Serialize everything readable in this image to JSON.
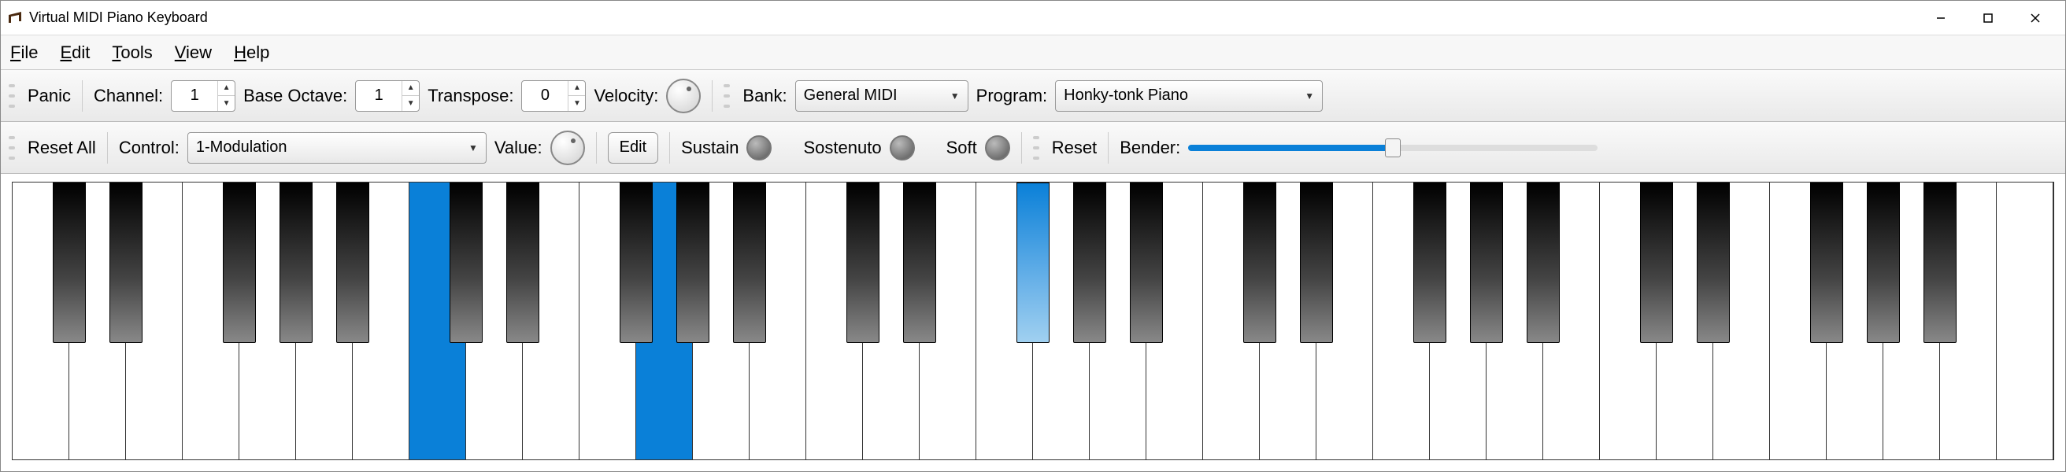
{
  "window": {
    "title": "Virtual MIDI Piano Keyboard"
  },
  "menu": {
    "file": "File",
    "edit": "Edit",
    "tools": "Tools",
    "view": "View",
    "help": "Help"
  },
  "toolbar1": {
    "panic": "Panic",
    "channel_label": "Channel:",
    "channel_value": "1",
    "base_octave_label": "Base Octave:",
    "base_octave_value": "1",
    "transpose_label": "Transpose:",
    "transpose_value": "0",
    "velocity_label": "Velocity:",
    "bank_label": "Bank:",
    "bank_value": "General MIDI",
    "program_label": "Program:",
    "program_value": "Honky-tonk Piano"
  },
  "toolbar2": {
    "reset_all": "Reset All",
    "control_label": "Control:",
    "control_value": "1-Modulation",
    "value_label": "Value:",
    "edit": "Edit",
    "sustain": "Sustain",
    "sostenuto": "Sostenuto",
    "soft": "Soft",
    "reset": "Reset",
    "bender_label": "Bender:"
  },
  "piano": {
    "white_keys": 36,
    "octaves_start": 0,
    "pressed_white_indices": [
      7,
      11
    ],
    "black_pattern_per_octave": [
      0,
      1,
      3,
      4,
      5
    ],
    "pressed_black_index": 12
  }
}
